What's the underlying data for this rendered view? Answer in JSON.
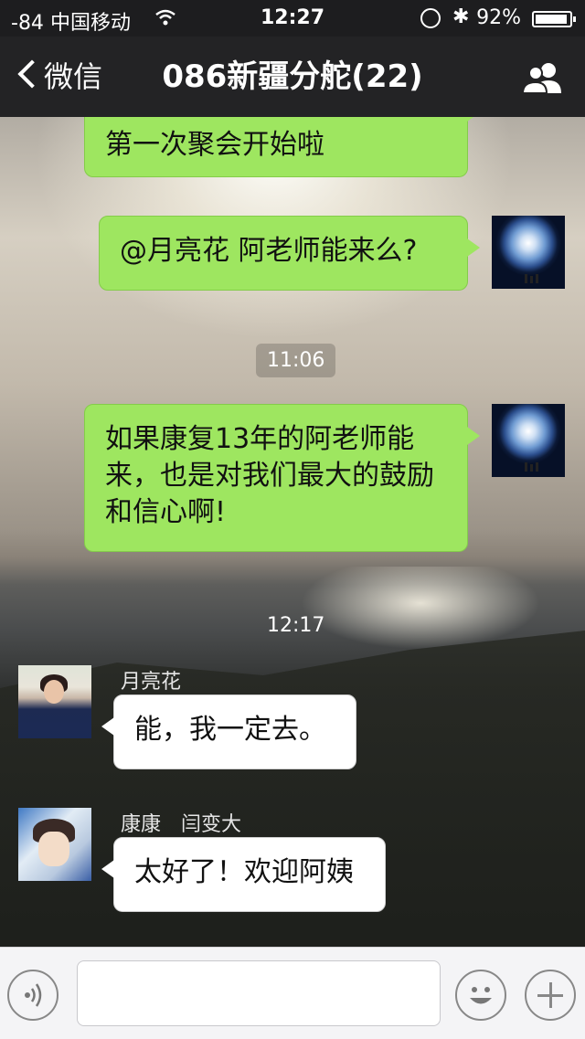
{
  "status_bar": {
    "signal": "-84",
    "carrier": "中国移动",
    "time": "12:27",
    "battery_percent": "92%",
    "battery_level": 0.92,
    "icons": [
      "wifi-icon",
      "rotation-lock-icon",
      "bluetooth-icon",
      "battery-icon"
    ]
  },
  "nav": {
    "back_label": "微信",
    "title": "086新疆分舵(22)",
    "right_icon": "group-members-icon"
  },
  "messages": [
    {
      "type": "me",
      "text": "第一次聚会开始啦",
      "partial_top": true
    },
    {
      "type": "me",
      "text": "@月亮花 阿老师能来么?"
    },
    {
      "type": "time",
      "text": "11:06"
    },
    {
      "type": "me",
      "text": "如果康复13年的阿老师能来，也是对我们最大的鼓励和信心啊!"
    },
    {
      "type": "time",
      "text": "12:17"
    },
    {
      "type": "other",
      "sender": "月亮花",
      "text": "能，我一定去。"
    },
    {
      "type": "other",
      "sender": "康康　闫变大",
      "text": "太好了！欢迎阿姨"
    }
  ],
  "input_bar": {
    "icons": [
      "voice-icon",
      "emoji-icon",
      "plus-icon"
    ],
    "input_value": ""
  },
  "colors": {
    "bubble_me": "#9ee660",
    "bubble_other": "#ffffff",
    "navbar": "#232325"
  }
}
